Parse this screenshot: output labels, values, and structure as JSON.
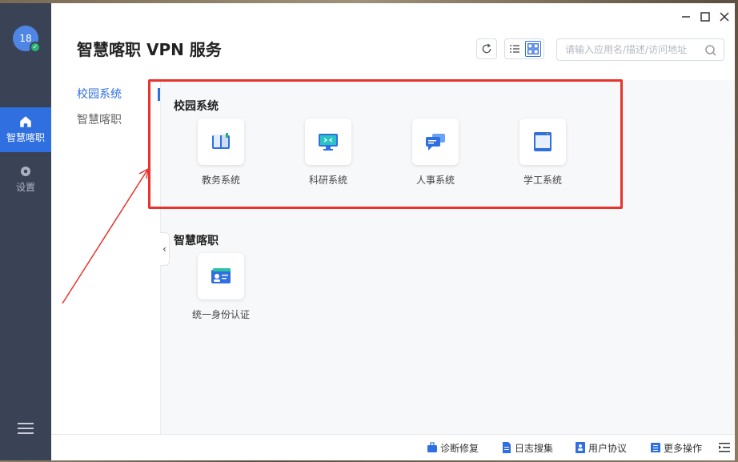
{
  "window": {
    "title": "智慧喀职 VPN 服务"
  },
  "user": {
    "avatar_text": "18"
  },
  "sidebar": {
    "items": [
      {
        "label": "智慧喀职",
        "icon": "home-icon"
      },
      {
        "label": "设置",
        "icon": "gear-icon"
      }
    ]
  },
  "search": {
    "placeholder": "请输入应用名/描述/访问地址",
    "value": ""
  },
  "categories": [
    {
      "label": "校园系统"
    },
    {
      "label": "智慧喀职"
    }
  ],
  "sections": [
    {
      "title": "校园系统",
      "apps": [
        {
          "label": "教务系统",
          "icon": "book-icon"
        },
        {
          "label": "科研系统",
          "icon": "monitor-icon"
        },
        {
          "label": "人事系统",
          "icon": "chat-icon"
        },
        {
          "label": "学工系统",
          "icon": "browser-window-icon"
        }
      ]
    },
    {
      "title": "智慧喀职",
      "apps": [
        {
          "label": "统一身份认证",
          "icon": "id-card-icon"
        }
      ]
    }
  ],
  "footer": {
    "diagnose": "诊断修复",
    "logs": "日志搜集",
    "agreement": "用户协议",
    "more": "更多操作"
  },
  "colors": {
    "sidebar_bg": "#3a4256",
    "accent": "#2f6fe0",
    "highlight": "#e8322b"
  }
}
